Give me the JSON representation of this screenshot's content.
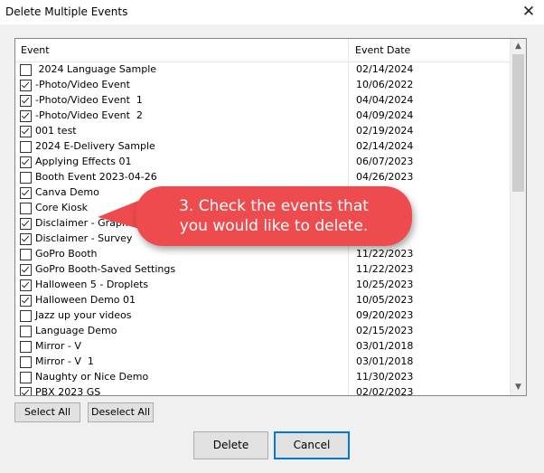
{
  "window": {
    "title": "Delete Multiple Events",
    "close_glyph": "✕"
  },
  "list": {
    "headers": {
      "event": "Event",
      "date": "Event Date"
    },
    "rows": [
      {
        "name": " 2024 Language Sample",
        "date": "02/14/2024",
        "checked": false
      },
      {
        "name": "-Photo/Video Event",
        "date": "10/06/2022",
        "checked": true
      },
      {
        "name": "-Photo/Video Event  1",
        "date": "04/04/2024",
        "checked": true
      },
      {
        "name": "-Photo/Video Event  2",
        "date": "04/09/2024",
        "checked": true
      },
      {
        "name": "001 test",
        "date": "02/19/2024",
        "checked": true
      },
      {
        "name": "2024 E-Delivery Sample",
        "date": "02/14/2024",
        "checked": false
      },
      {
        "name": "Applying Effects 01",
        "date": "06/07/2023",
        "checked": true
      },
      {
        "name": "Booth Event 2023-04-26",
        "date": "04/26/2023",
        "checked": false
      },
      {
        "name": "Canva Demo",
        "date": "",
        "checked": true
      },
      {
        "name": "Core Kiosk",
        "date": "",
        "checked": false
      },
      {
        "name": "Disclaimer - Graphic",
        "date": "",
        "checked": true
      },
      {
        "name": "Disclaimer - Survey",
        "date": "",
        "checked": true
      },
      {
        "name": "GoPro Booth",
        "date": "11/22/2023",
        "checked": false
      },
      {
        "name": "GoPro Booth-Saved Settings",
        "date": "11/22/2023",
        "checked": true
      },
      {
        "name": "Halloween 5 - Droplets",
        "date": "10/25/2023",
        "checked": true
      },
      {
        "name": "Halloween Demo 01",
        "date": "10/05/2023",
        "checked": true
      },
      {
        "name": "Jazz up your videos",
        "date": "09/20/2023",
        "checked": false
      },
      {
        "name": "Language Demo",
        "date": "02/15/2023",
        "checked": false
      },
      {
        "name": "Mirror - V",
        "date": "03/01/2018",
        "checked": false
      },
      {
        "name": "Mirror - V  1",
        "date": "03/01/2018",
        "checked": false
      },
      {
        "name": "Naughty or Nice Demo",
        "date": "11/30/2023",
        "checked": false
      },
      {
        "name": "PBX 2023 GS",
        "date": "02/02/2023",
        "checked": true
      }
    ]
  },
  "buttons": {
    "select_all": "Select All",
    "deselect_all": "Deselect All",
    "delete": "Delete",
    "cancel": "Cancel"
  },
  "callout": {
    "line1": "3. Check the events that",
    "line2": "you would like to delete.",
    "color": "#ee4b4e"
  }
}
